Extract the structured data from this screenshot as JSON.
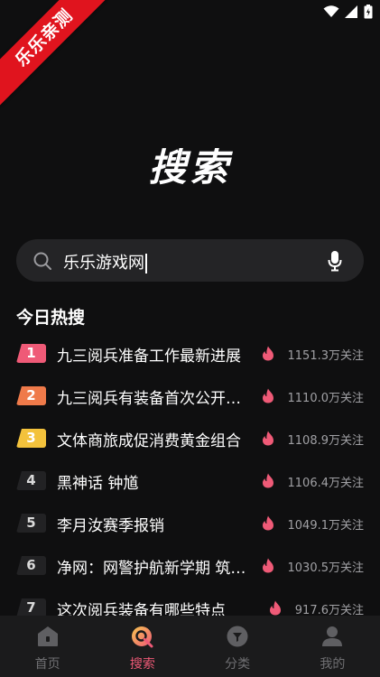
{
  "ribbon": {
    "text": "乐乐亲测"
  },
  "page": {
    "title": "搜索"
  },
  "search": {
    "query": "乐乐游戏网"
  },
  "hot": {
    "heading": "今日热搜",
    "items": [
      {
        "rank": "1",
        "title": "九三阅兵准备工作最新进展",
        "count": "1151.3万关注"
      },
      {
        "rank": "2",
        "title": "九三阅兵有装备首次公开亮相",
        "count": "1110.0万关注"
      },
      {
        "rank": "3",
        "title": "文体商旅成促消费黄金组合",
        "count": "1108.9万关注"
      },
      {
        "rank": "4",
        "title": "黑神话 钟馗",
        "count": "1106.4万关注"
      },
      {
        "rank": "5",
        "title": "李月汝赛季报销",
        "count": "1049.1万关注"
      },
      {
        "rank": "6",
        "title": "净网：网警护航新学期 筑牢安全防线",
        "count": "1030.5万关注"
      },
      {
        "rank": "7",
        "title": "这次阅兵装备有哪些特点",
        "count": "917.6万关注"
      }
    ]
  },
  "nav": {
    "home": "首页",
    "search": "搜索",
    "category": "分类",
    "mine": "我的"
  },
  "colors": {
    "accent": "#ef5a77",
    "rank2": "#ef7a4a",
    "rank3": "#f3c23c"
  }
}
